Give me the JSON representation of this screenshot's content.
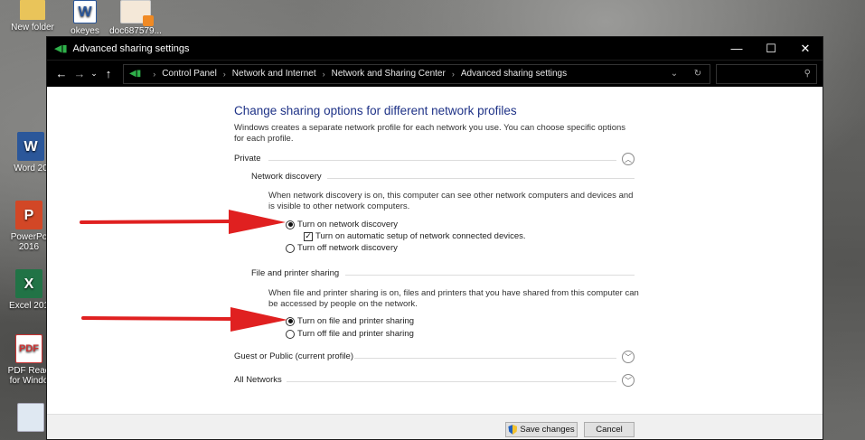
{
  "desktop": {
    "icons": [
      {
        "label": "New folder",
        "icon": "folder-icon"
      },
      {
        "label": "okeyes",
        "icon": "word-doc-icon"
      },
      {
        "label": "doc687579...",
        "icon": "image-doc-icon"
      },
      {
        "label": "Word 20",
        "icon": "word-app-icon"
      },
      {
        "label": "PowerPo 2016",
        "icon": "powerpoint-app-icon"
      },
      {
        "label": "Excel 201",
        "icon": "excel-app-icon"
      },
      {
        "label": "PDF Read for Windo",
        "icon": "pdf-reader-icon"
      },
      {
        "label": "",
        "icon": "file-icon"
      }
    ]
  },
  "window": {
    "title": "Advanced sharing settings",
    "controls": {
      "minimize": "—",
      "maximize": "☐",
      "close": "✕"
    }
  },
  "address": {
    "back": "←",
    "forward": "→",
    "recent": "⌄",
    "up": "↑",
    "breadcrumbs": [
      "Control Panel",
      "Network and Internet",
      "Network and Sharing Center",
      "Advanced sharing settings"
    ],
    "dropdown": "⌄",
    "refresh": "↻",
    "search_icon": "⚲"
  },
  "page": {
    "heading": "Change sharing options for different network profiles",
    "intro": "Windows creates a separate network profile for each network you use. You can choose specific options for each profile.",
    "private": {
      "label": "Private",
      "expanded": true,
      "network_discovery": {
        "label": "Network discovery",
        "description": "When network discovery is on, this computer can see other network computers and devices and is visible to other network computers.",
        "on_label": "Turn on network discovery",
        "auto_setup_label": "Turn on automatic setup of network connected devices.",
        "off_label": "Turn off network discovery",
        "selected": "on",
        "auto_setup_checked": true
      },
      "file_printer_sharing": {
        "label": "File and printer sharing",
        "description": "When file and printer sharing is on, files and printers that you have shared from this computer can be accessed by people on the network.",
        "on_label": "Turn on file and printer sharing",
        "off_label": "Turn off file and printer sharing",
        "selected": "on"
      }
    },
    "guest_public": {
      "label": "Guest or Public (current profile)",
      "expanded": false
    },
    "all_networks": {
      "label": "All Networks",
      "expanded": false
    }
  },
  "footer": {
    "save_label": "Save changes",
    "cancel_label": "Cancel"
  },
  "annotation": {
    "arrow_color": "#e02020"
  }
}
